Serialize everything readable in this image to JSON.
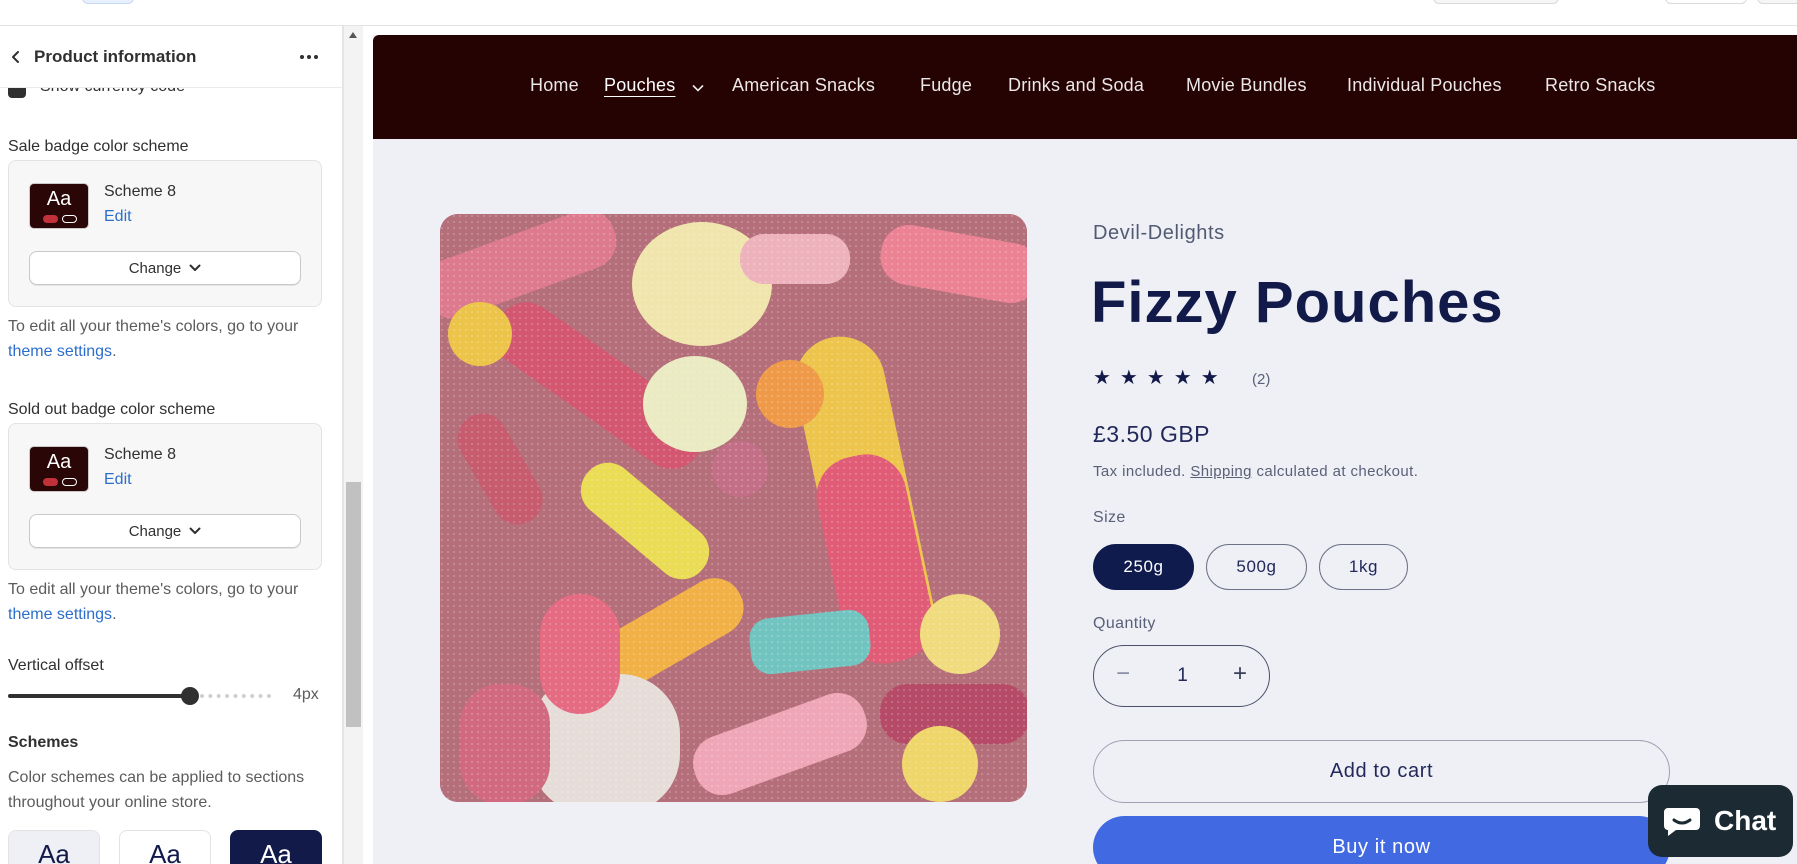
{
  "panel": {
    "title": "Product information",
    "cut_text": "Show currency code",
    "sale_label": "Sale badge color scheme",
    "sale_scheme": {
      "swatch": "Aa",
      "name": "Scheme 8",
      "edit": "Edit",
      "change": "Change"
    },
    "help1_prefix": "To edit all your theme's colors, go to your ",
    "help1_link": "theme settings",
    "help_suffix": ".",
    "soldout_label": "Sold out badge color scheme",
    "soldout_scheme": {
      "swatch": "Aa",
      "name": "Scheme 8",
      "edit": "Edit",
      "change": "Change"
    },
    "help2_prefix": "To edit all your theme's colors, go to your ",
    "help2_link": "theme settings",
    "offset_label": "Vertical offset",
    "offset_value": "4px",
    "offset_fraction": 0.66,
    "schemes_heading": "Schemes",
    "schemes_desc": "Color schemes can be applied to sections throughout your online store.",
    "scheme_thumbs": [
      "Aa",
      "Aa",
      "Aa"
    ]
  },
  "store": {
    "nav": [
      "Home",
      "Pouches",
      "American Snacks",
      "Fudge",
      "Drinks and Soda",
      "Movie Bundles",
      "Individual Pouches",
      "Retro Snacks"
    ],
    "vendor": "Devil-Delights",
    "title": "Fizzy Pouches",
    "stars": "★★★★★",
    "rating": 5,
    "review_count": "(2)",
    "price": "£3.50 GBP",
    "tax_prefix": "Tax included. ",
    "tax_link": "Shipping",
    "tax_suffix": " calculated at checkout.",
    "size_label": "Size",
    "sizes": [
      "250g",
      "500g",
      "1kg"
    ],
    "quantity_label": "Quantity",
    "quantity": "1",
    "minus": "−",
    "plus": "+",
    "add_to_cart": "Add to cart",
    "buy_now": "Buy it now"
  },
  "chat": {
    "label": "Chat"
  },
  "colors": {
    "nav_bg": "#250303",
    "title": "#121a4a",
    "buy_now": "#4169e1",
    "accent_link": "#2c6ecb"
  }
}
